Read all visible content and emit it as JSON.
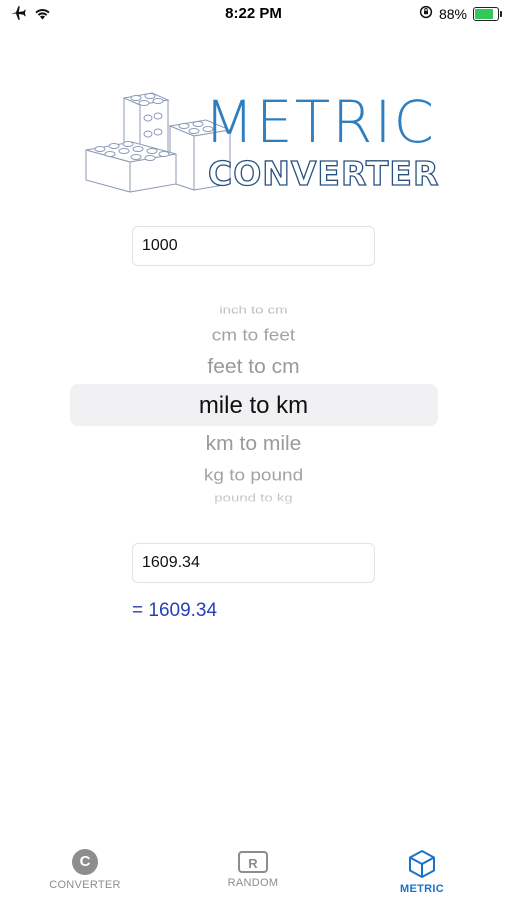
{
  "status_bar": {
    "time": "8:22 PM",
    "battery": "88%",
    "battery_level": 0.88,
    "icons": [
      "airplane-icon",
      "wifi-icon",
      "orientation-lock-icon",
      "battery-icon"
    ]
  },
  "logo": {
    "line1": "METRIC",
    "line2": "CONVERTER",
    "colors": {
      "line1": "#2f7fc0",
      "line2": "#28517f"
    }
  },
  "input": {
    "value": "1000"
  },
  "picker": {
    "items": [
      "inch to cm",
      "cm to feet",
      "feet to cm",
      "mile to km",
      "km to mile",
      "kg to pound",
      "pound to kg"
    ],
    "selected": "mile to km"
  },
  "output": {
    "value": "1609.34"
  },
  "result": {
    "text": "= 1609.34",
    "color": "#2540b8"
  },
  "tabbar": {
    "tabs": [
      {
        "label": "CONVERTER",
        "icon": "C"
      },
      {
        "label": "RANDOM",
        "icon": "R"
      },
      {
        "label": "METRIC",
        "icon": "cube-icon"
      }
    ],
    "active_color": "#1a72c9",
    "inactive_color": "#8d8d8d"
  }
}
